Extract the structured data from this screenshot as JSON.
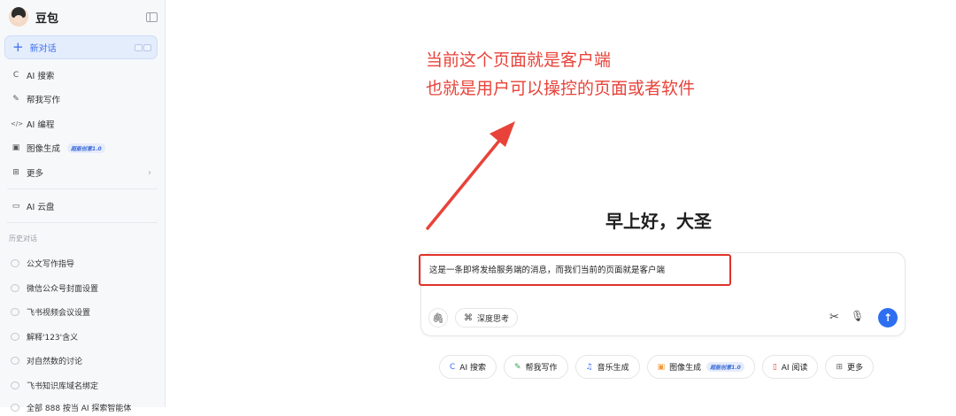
{
  "colors": {
    "accent": "#2e6ef0",
    "annotation": "#e8433a"
  },
  "sidebar": {
    "brand": "豆包",
    "new_chat": "新对话",
    "nav": [
      {
        "icon": "ai-search-icon",
        "glyph": "C",
        "label": "AI 搜索"
      },
      {
        "icon": "writing-icon",
        "glyph": "✎",
        "label": "帮我写作"
      },
      {
        "icon": "code-icon",
        "glyph": "</>",
        "label": "AI 编程"
      },
      {
        "icon": "image-icon",
        "glyph": "▣",
        "label": "图像生成",
        "badge": "超能创意1.0"
      },
      {
        "icon": "more-icon",
        "glyph": "⊞",
        "label": "更多"
      },
      {
        "icon": "cloud-drive-icon",
        "glyph": "▭",
        "label": "AI 云盘"
      }
    ],
    "history_title": "历史对话",
    "history": [
      "公文写作指导",
      "微信公众号封面设置",
      "飞书视频会议设置",
      "解释'123'含义",
      "对自然数的讨论",
      "飞书知识库域名绑定",
      "全部 888 按当 AI 探索智能体"
    ]
  },
  "annotation": {
    "line1": "当前这个页面就是客户端",
    "line2": "也就是用户可以操控的页面或者软件"
  },
  "main": {
    "greeting": "早上好，大圣",
    "message": "这是一条即将发给服务端的消息，而我们当前的页面就是客户端",
    "deep_thinking": "深度思考"
  },
  "chips": [
    {
      "icon": "ai-search-icon",
      "glyph": "C",
      "color": "#3b6ef0",
      "label": "AI 搜索"
    },
    {
      "icon": "writing-icon",
      "glyph": "✎",
      "color": "#2ea44f",
      "label": "帮我写作"
    },
    {
      "icon": "music-icon",
      "glyph": "♫",
      "color": "#3b6ef0",
      "label": "音乐生成"
    },
    {
      "icon": "image-icon",
      "glyph": "▣",
      "color": "#f29c38",
      "label": "图像生成",
      "badge": "超能创意1.0"
    },
    {
      "icon": "reading-icon",
      "glyph": "▯",
      "color": "#e8433a",
      "label": "AI 阅读"
    },
    {
      "icon": "more-icon",
      "glyph": "⊞",
      "color": "#666666",
      "label": "更多"
    }
  ]
}
